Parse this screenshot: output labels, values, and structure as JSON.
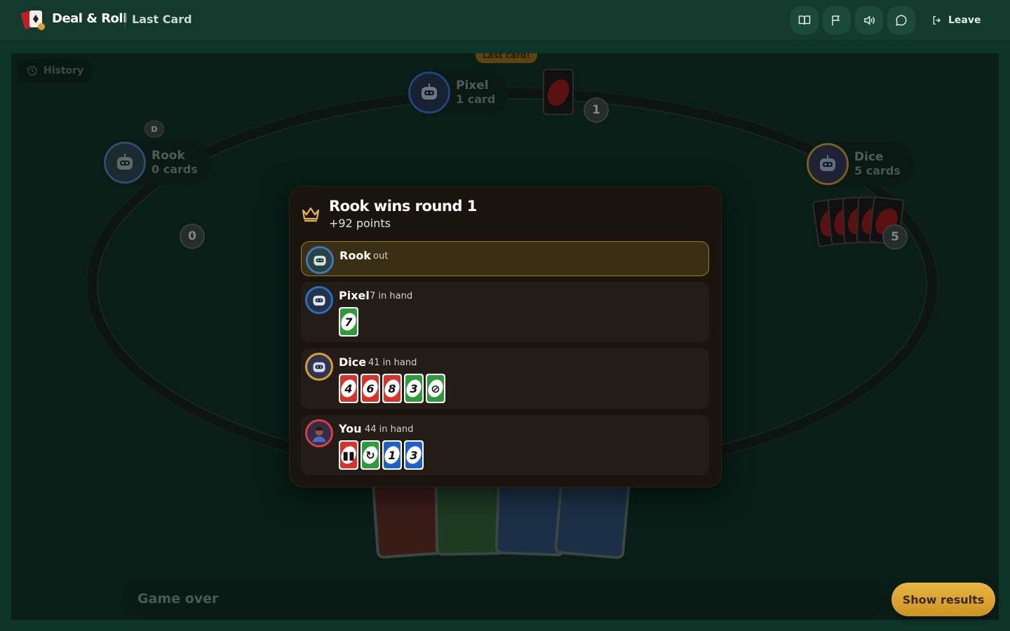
{
  "header": {
    "brand": "Deal & Roll",
    "game_name": "Last Card",
    "buttons": [
      "book-icon",
      "flag-icon",
      "volume-icon",
      "chat-icon"
    ],
    "leave_label": "Leave"
  },
  "table": {
    "history_label": "History",
    "dealer_label": "D",
    "last_card_tag": "Last card!",
    "players": [
      {
        "name": "Rook",
        "count_text": "0 cards",
        "bubble": "0"
      },
      {
        "name": "Pixel",
        "count_text": "1 card",
        "bubble": "1"
      },
      {
        "name": "Dice",
        "count_text": "5 cards",
        "bubble": "5"
      }
    ],
    "status_text": "Game over",
    "show_results_label": "Show results"
  },
  "modal": {
    "title": "Rook wins round 1",
    "subtitle": "+92 points",
    "rows": [
      {
        "name": "Rook",
        "info": "out",
        "cards": []
      },
      {
        "name": "Pixel",
        "info": "7 in hand",
        "cards": [
          {
            "label": "7",
            "color": "#2e9b3a"
          }
        ]
      },
      {
        "name": "Dice",
        "info": "41 in hand",
        "cards": [
          {
            "label": "4",
            "color": "#d6332a"
          },
          {
            "label": "6",
            "color": "#d6332a"
          },
          {
            "label": "8",
            "color": "#d6332a"
          },
          {
            "label": "3",
            "color": "#2e9b3a"
          },
          {
            "label": "⊘",
            "color": "#2e9b3a"
          }
        ]
      },
      {
        "name": "You",
        "info": "44 in hand",
        "cards": [
          {
            "label": "▮▮",
            "color": "#d6332a"
          },
          {
            "label": "↻",
            "color": "#2e9b3a"
          },
          {
            "label": "1",
            "color": "#1f5fc8"
          },
          {
            "label": "3",
            "color": "#1f5fc8"
          }
        ]
      }
    ]
  },
  "colors": {
    "accent_gold": "#e8b642",
    "card_red": "#d6332a",
    "card_green": "#2e9b3a",
    "card_blue": "#1f5fc8"
  }
}
